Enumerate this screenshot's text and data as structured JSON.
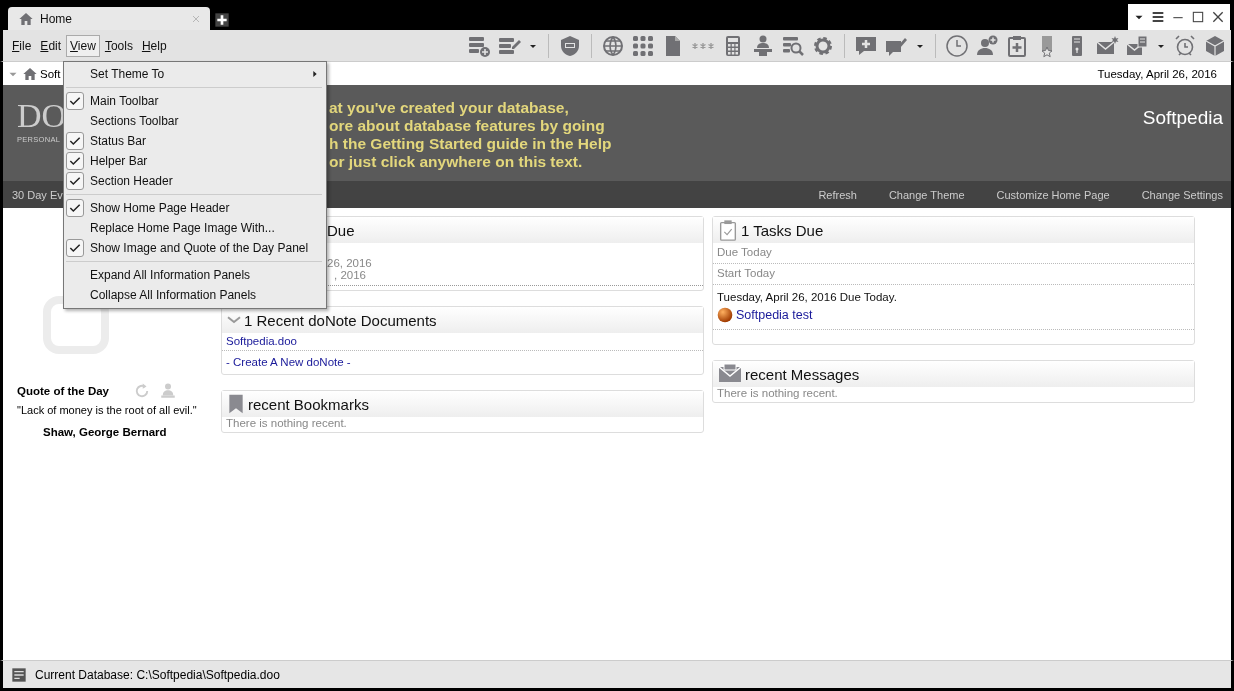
{
  "tabs": [
    {
      "label": "Home",
      "selected": true
    }
  ],
  "menu_bar": [
    {
      "label": "File",
      "selected": false
    },
    {
      "label": "Edit",
      "selected": false
    },
    {
      "label": "View",
      "selected": true
    },
    {
      "label": "Tools",
      "selected": false
    },
    {
      "label": "Help",
      "selected": false
    }
  ],
  "address_bar": {
    "location": "Soft",
    "date": "Tuesday, April 26, 2016"
  },
  "header": {
    "logo": "DO",
    "tagline": "PERSONAL",
    "message_lines": [
      "at you've created your database,",
      "ore about database features by going",
      "h the Getting Started guide in the Help",
      "or just click anywhere on this text."
    ],
    "user": "Softpedia"
  },
  "nav_bar": {
    "trial": "30 Day Ev",
    "links": [
      "Refresh",
      "Change Theme",
      "Customize Home Page",
      "Change Settings"
    ]
  },
  "quote_panel": {
    "title": "Quote of the Day",
    "text": "\"Lack of money is the root of all evil.\"",
    "author": "Shaw, George Bernard"
  },
  "left_panels": [
    {
      "kind": "events",
      "title": "Due",
      "lines": [
        "26, 2016",
        ", 2016"
      ]
    },
    {
      "kind": "documents",
      "title": "1 Recent doNote Documents",
      "items": [
        "Softpedia.doo"
      ],
      "action": "- Create A New doNote -"
    },
    {
      "kind": "bookmarks",
      "title": "recent Bookmarks",
      "empty": "There is nothing recent."
    }
  ],
  "right_panels": [
    {
      "kind": "tasks",
      "title": "1 Tasks Due",
      "sections": [
        "Due Today",
        "Start Today"
      ],
      "date_line": "Tuesday, April 26, 2016 Due Today.",
      "tasks": [
        "Softpedia test"
      ]
    },
    {
      "kind": "messages",
      "title": "recent Messages",
      "empty": "There is nothing recent."
    }
  ],
  "view_menu": [
    {
      "kind": "submenu",
      "label": "Set Theme To"
    },
    {
      "kind": "separator"
    },
    {
      "kind": "check",
      "label": "Main Toolbar",
      "checked": true
    },
    {
      "kind": "check",
      "label": "Sections Toolbar",
      "checked": false
    },
    {
      "kind": "check",
      "label": "Status Bar",
      "checked": true
    },
    {
      "kind": "check",
      "label": "Helper Bar",
      "checked": true
    },
    {
      "kind": "check",
      "label": "Section Header",
      "checked": true
    },
    {
      "kind": "separator"
    },
    {
      "kind": "check",
      "label": "Show Home Page Header",
      "checked": true
    },
    {
      "kind": "command",
      "label": "Replace Home Page Image With..."
    },
    {
      "kind": "check",
      "label": "Show Image and Quote of the Day Panel",
      "checked": true
    },
    {
      "kind": "separator"
    },
    {
      "kind": "command",
      "label": "Expand All Information Panels"
    },
    {
      "kind": "command",
      "label": "Collapse All Information Panels"
    }
  ],
  "status_bar": {
    "text": "Current Database: C:\\Softpedia\\Softpedia.doo"
  }
}
